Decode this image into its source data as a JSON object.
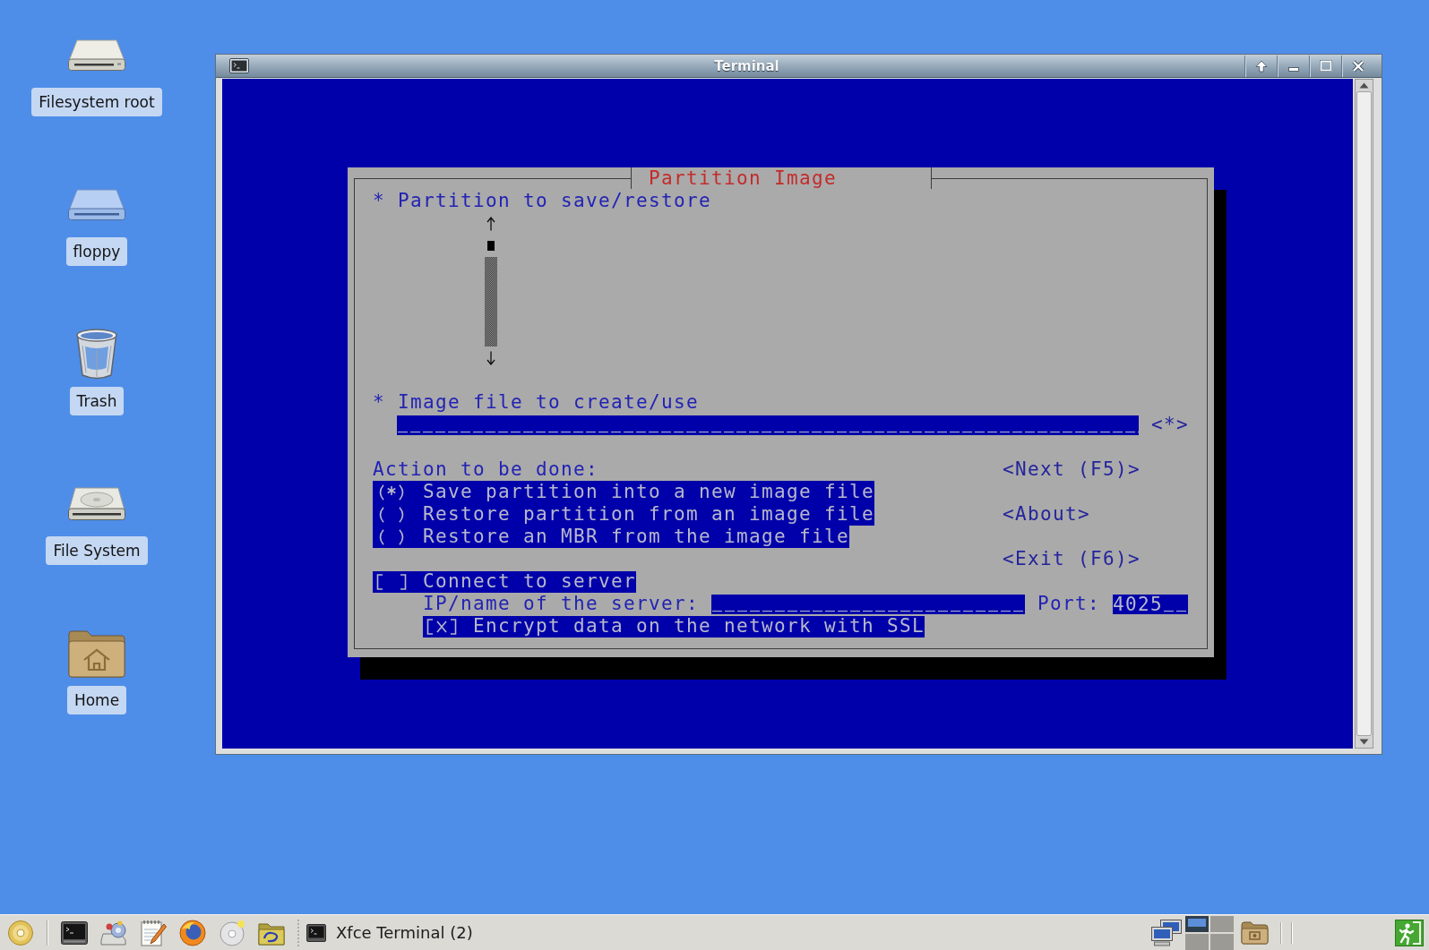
{
  "desktop_icons": [
    {
      "label": "Filesystem root",
      "kind": "drive"
    },
    {
      "label": "floppy",
      "kind": "floppy"
    },
    {
      "label": "Trash",
      "kind": "trash"
    },
    {
      "label": "File System",
      "kind": "harddisk"
    },
    {
      "label": "Home",
      "kind": "home"
    }
  ],
  "window": {
    "title": "Terminal",
    "dialog": {
      "title": "Partition Image",
      "partition_label": "* Partition to save/restore",
      "image_file": {
        "label": "* Image file to create/use",
        "browse_button": "<*>"
      },
      "action_label": "Action to be done:",
      "actions": [
        {
          "label": "Save partition into a new image file",
          "selected": true
        },
        {
          "label": "Restore partition from an image file",
          "selected": false
        },
        {
          "label": "Restore an MBR from the image file",
          "selected": false
        }
      ],
      "connect": {
        "label": "Connect to server",
        "checked": false
      },
      "server": {
        "label": "IP/name of the server:",
        "port_label": "Port:",
        "port_value": "4025"
      },
      "encrypt": {
        "label": "Encrypt data on the network with SSL",
        "checked": true
      },
      "buttons": [
        {
          "label": "<Next (F5)>"
        },
        {
          "label": "<About>"
        },
        {
          "label": "<Exit (F6)>"
        }
      ]
    }
  },
  "taskbar": {
    "tasks": [
      {
        "label": "Xfce Terminal (2)"
      }
    ],
    "workspaces": [
      {
        "selected": true
      },
      {
        "selected": false
      },
      {
        "selected": false
      },
      {
        "selected": false
      }
    ]
  }
}
